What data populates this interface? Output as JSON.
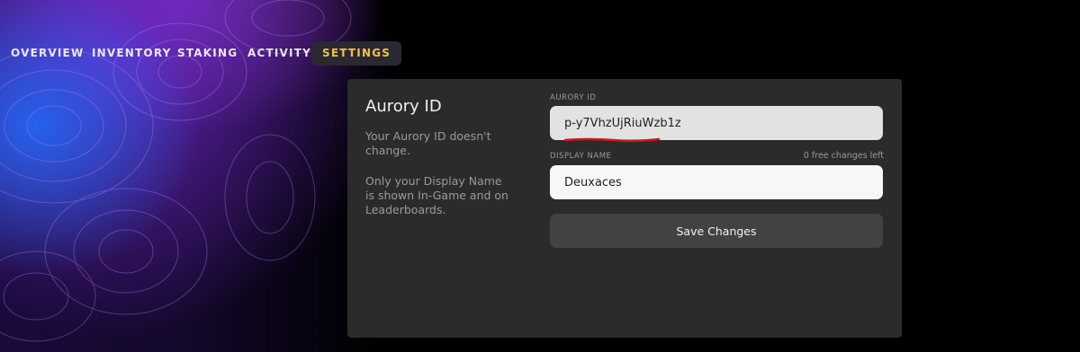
{
  "nav": {
    "tabs": [
      {
        "label": "OVERVIEW",
        "active": false
      },
      {
        "label": "INVENTORY",
        "active": false
      },
      {
        "label": "STAKING",
        "active": false
      },
      {
        "label": "ACTIVITY",
        "active": false
      },
      {
        "label": "SETTINGS",
        "active": true
      }
    ]
  },
  "card": {
    "title": "Aurory ID",
    "desc_1": "Your Aurory ID doesn't change.",
    "desc_2": "Only your Display Name is shown In-Game and on Leaderboards.",
    "aurory_id_label": "AURORY ID",
    "aurory_id_value": "p-y7VhzUjRiuWzb1z",
    "display_name_label": "DISPLAY NAME",
    "free_changes": "0 free changes left",
    "display_name_value": "Deuxaces",
    "save_label": "Save Changes"
  },
  "colors": {
    "active_tab": "#f2c14a",
    "annotation_underline": "#d01818",
    "card_bg": "#2b2b2b"
  }
}
